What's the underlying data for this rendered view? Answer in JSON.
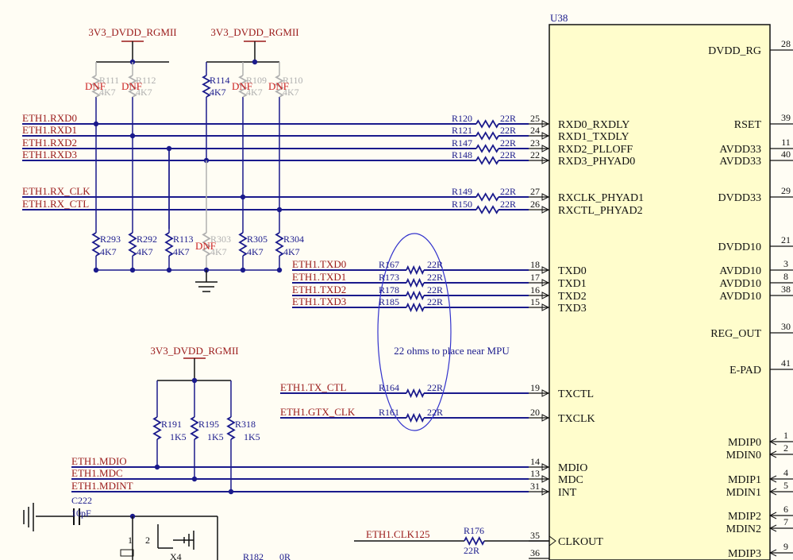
{
  "chip": {
    "ref": "U38",
    "left_pins": [
      {
        "num": "25",
        "name": "RXD0_RXDLY"
      },
      {
        "num": "24",
        "name": "RXD1_TXDLY"
      },
      {
        "num": "23",
        "name": "RXD2_PLLOFF"
      },
      {
        "num": "22",
        "name": "RXD3_PHYAD0"
      },
      {
        "num": "27",
        "name": "RXCLK_PHYAD1"
      },
      {
        "num": "26",
        "name": "RXCTL_PHYAD2"
      },
      {
        "num": "18",
        "name": "TXD0"
      },
      {
        "num": "17",
        "name": "TXD1"
      },
      {
        "num": "16",
        "name": "TXD2"
      },
      {
        "num": "15",
        "name": "TXD3"
      },
      {
        "num": "19",
        "name": "TXCTL"
      },
      {
        "num": "20",
        "name": "TXCLK"
      },
      {
        "num": "14",
        "name": "MDIO"
      },
      {
        "num": "13",
        "name": "MDC"
      },
      {
        "num": "31",
        "name": "INT"
      },
      {
        "num": "35",
        "name": "CLKOUT"
      },
      {
        "num": "36",
        "name": ""
      }
    ],
    "right_pins": [
      {
        "num": "28",
        "name": "DVDD_RG"
      },
      {
        "num": "39",
        "name": "RSET"
      },
      {
        "num": "11",
        "name": "AVDD33"
      },
      {
        "num": "40",
        "name": "AVDD33"
      },
      {
        "num": "29",
        "name": "DVDD33"
      },
      {
        "num": "21",
        "name": "DVDD10"
      },
      {
        "num": "3",
        "name": "AVDD10"
      },
      {
        "num": "8",
        "name": "AVDD10"
      },
      {
        "num": "38",
        "name": "AVDD10"
      },
      {
        "num": "30",
        "name": "REG_OUT"
      },
      {
        "num": "41",
        "name": "E-PAD"
      },
      {
        "num": "1",
        "name": "MDIP0"
      },
      {
        "num": "2",
        "name": "MDIN0"
      },
      {
        "num": "4",
        "name": "MDIP1"
      },
      {
        "num": "5",
        "name": "MDIN1"
      },
      {
        "num": "6",
        "name": "MDIP2"
      },
      {
        "num": "7",
        "name": "MDIN2"
      },
      {
        "num": "9",
        "name": "MDIP3"
      }
    ]
  },
  "nets": [
    "ETH1.RXD0",
    "ETH1.RXD1",
    "ETH1.RXD2",
    "ETH1.RXD3",
    "ETH1.RX_CLK",
    "ETH1.RX_CTL",
    "ETH1.TXD0",
    "ETH1.TXD1",
    "ETH1.TXD2",
    "ETH1.TXD3",
    "ETH1.TX_CTL",
    "ETH1.GTX_CLK",
    "ETH1.MDIO",
    "ETH1.MDC",
    "ETH1.MDINT",
    "ETH1.CLK125"
  ],
  "series_resistors": [
    {
      "ref": "R120",
      "value": "22R"
    },
    {
      "ref": "R121",
      "value": "22R"
    },
    {
      "ref": "R147",
      "value": "22R"
    },
    {
      "ref": "R148",
      "value": "22R"
    },
    {
      "ref": "R149",
      "value": "22R"
    },
    {
      "ref": "R150",
      "value": "22R"
    },
    {
      "ref": "R167",
      "value": "22R"
    },
    {
      "ref": "R173",
      "value": "22R"
    },
    {
      "ref": "R178",
      "value": "22R"
    },
    {
      "ref": "R185",
      "value": "22R"
    },
    {
      "ref": "R164",
      "value": "22R"
    },
    {
      "ref": "R161",
      "value": "22R"
    },
    {
      "ref": "R176",
      "value": "22R"
    }
  ],
  "power_labels": [
    "3V3_DVDD_RGMII",
    "3V3_DVDD_RGMII",
    "3V3_DVDD_RGMII"
  ],
  "pullups": [
    {
      "ref": "R111",
      "value": "4K7",
      "dnf": "DNF"
    },
    {
      "ref": "R112",
      "value": "4K7",
      "dnf": "DNF"
    },
    {
      "ref": "R114",
      "value": "4K7",
      "dnf": ""
    },
    {
      "ref": "R109",
      "value": "4K7",
      "dnf": "DNF"
    },
    {
      "ref": "R110",
      "value": "4K7",
      "dnf": "DNF"
    }
  ],
  "pulldowns": [
    {
      "ref": "R293",
      "value": "4K7",
      "dnf": ""
    },
    {
      "ref": "R292",
      "value": "4K7",
      "dnf": ""
    },
    {
      "ref": "R113",
      "value": "4K7",
      "dnf": ""
    },
    {
      "ref": "R303",
      "value": "4K7",
      "dnf": "DNF"
    },
    {
      "ref": "R305",
      "value": "4K7",
      "dnf": ""
    },
    {
      "ref": "R304",
      "value": "4K7",
      "dnf": ""
    }
  ],
  "mdio_pullups": [
    {
      "ref": "R191",
      "value": "1K5"
    },
    {
      "ref": "R195",
      "value": "1K5"
    },
    {
      "ref": "R318",
      "value": "1K5"
    }
  ],
  "annotation": "22 ohms to place near MPU",
  "cap": {
    "ref": "C222",
    "value": "10pF"
  },
  "bottom": {
    "x4": "X4",
    "pin1": "1",
    "pin2": "2",
    "r182": "R182",
    "r182_value": "0R"
  }
}
